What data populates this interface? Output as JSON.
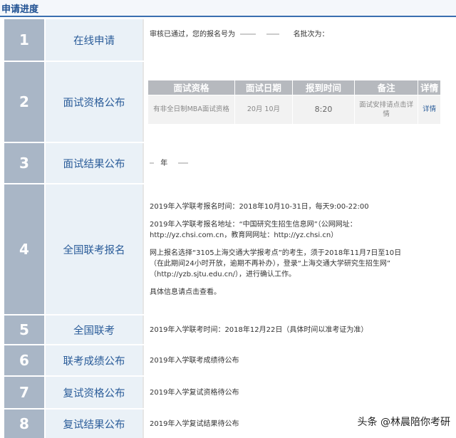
{
  "header": {
    "title": "申请进度"
  },
  "steps": [
    {
      "num": "1",
      "label": "在线申请",
      "lines": [
        "审核已通过，您的报名号为",
        "名批次为："
      ]
    },
    {
      "num": "2",
      "label": "面试资格公布",
      "table": {
        "headers": [
          "面试资格",
          "面试日期",
          "报到时间",
          "备注",
          "详情"
        ],
        "row": [
          "有非全日制MBA面试资格",
          "20月  10月",
          "8:20",
          "面试安排请点击详情",
          "详情"
        ]
      }
    },
    {
      "num": "3",
      "label": "面试结果公布",
      "lines": [
        "年"
      ]
    },
    {
      "num": "4",
      "label": "全国联考报名",
      "lines": [
        "2019年入学联考报名时间：2018年10月10-31日，每天9:00-22:00",
        "2019年入学联考报名地址：“中国研究生招生信息网”（公网网址：",
        "http://yz.chsi.com.cn，教育网网址：http://yz.chsi.cn）",
        "网上报名选择“3105上海交通大学报考点”的考生，须于2018年11月7日至10日",
        "（在此期间24小时开放，逾期不再补办），登录“上海交通大学研究生招生网”",
        "（http://yzb.sjtu.edu.cn/），进行确认工作。",
        "具体信息请点击查看。"
      ]
    },
    {
      "num": "5",
      "label": "全国联考",
      "lines": [
        "2019年入学联考时间：2018年12月22日（具体时间以准考证为准）"
      ]
    },
    {
      "num": "6",
      "label": "联考成绩公布",
      "lines": [
        "2019年入学联考成绩待公布"
      ]
    },
    {
      "num": "7",
      "label": "复试资格公布",
      "lines": [
        "2019年入学复试资格待公布"
      ]
    },
    {
      "num": "8",
      "label": "复试结果公布",
      "lines": [
        "2019年入学复试结果待公布"
      ]
    }
  ],
  "watermark": "头条 @林晨陪你考研"
}
